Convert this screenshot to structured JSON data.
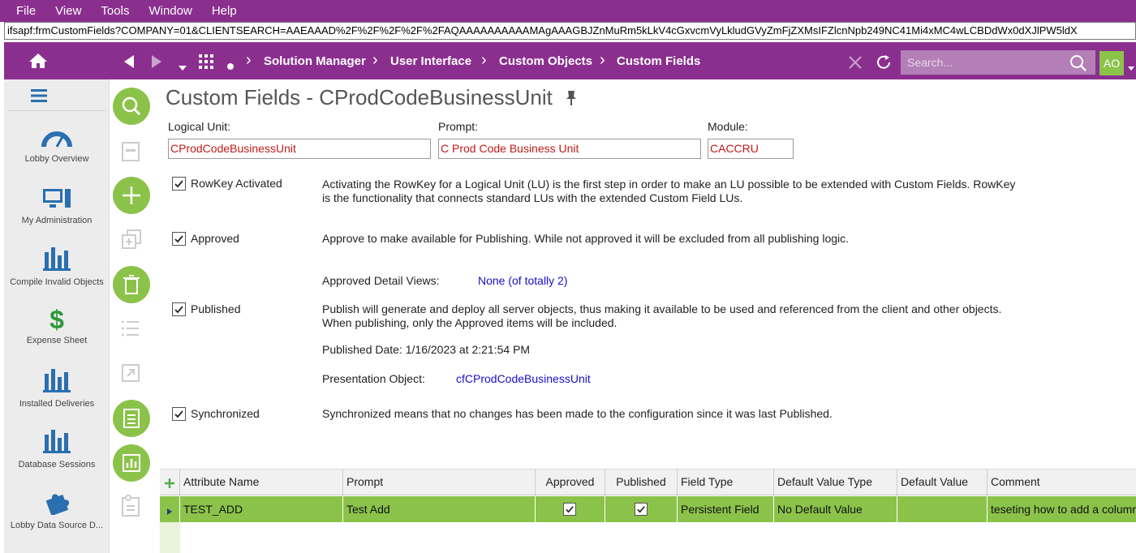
{
  "menubar": {
    "file": "File",
    "view": "View",
    "tools": "Tools",
    "window": "Window",
    "help": "Help"
  },
  "url": "ifsapf:frmCustomFields?COMPANY=01&CLIENTSEARCH=AAEAAAD%2F%2F%2F%2F%2FAQAAAAAAAAAAMAgAAAGBJZnMuRm5kLkV4cGxvcmVyLkludGVyZmFjZXMsIFZlcnNpb249NC41Mi4xMC4wLCBDdWx0dXJlPW5ldX",
  "nav": {
    "breadcrumbs": [
      "Solution Manager",
      "User Interface",
      "Custom Objects",
      "Custom Fields"
    ],
    "search_placeholder": "Search...",
    "avatar": "AO"
  },
  "sidebar": {
    "items": [
      {
        "label": "Lobby Overview",
        "icon": "gauge-icon"
      },
      {
        "label": "My Administration",
        "icon": "computer-icon"
      },
      {
        "label": "Compile Invalid Objects",
        "icon": "bar-chart-icon"
      },
      {
        "label": "Expense Sheet",
        "icon": "dollar-icon"
      },
      {
        "label": "Installed Deliveries",
        "icon": "bar-chart-icon"
      },
      {
        "label": "Database Sessions",
        "icon": "bar-chart-icon"
      },
      {
        "label": "Lobby Data Source D...",
        "icon": "puzzle-icon"
      }
    ]
  },
  "page": {
    "title": "Custom Fields - CProdCodeBusinessUnit",
    "logical_unit_label": "Logical Unit:",
    "logical_unit_value": "CProdCodeBusinessUnit",
    "prompt_label": "Prompt:",
    "prompt_value": "C Prod Code Business Unit",
    "module_label": "Module:",
    "module_value": "CACCRU",
    "rowkey_label": "RowKey Activated",
    "rowkey_desc_1": "Activating the RowKey for a Logical Unit (LU) is the first step in order to make an LU possible to be extended with Custom Fields. RowKey",
    "rowkey_desc_2": "is the functionality that connects standard LUs with the extended Custom Field LUs.",
    "approved_label": "Approved",
    "approved_desc": "Approve to make available for Publishing. While not approved it will be excluded from all publishing logic.",
    "approved_views_label": "Approved Detail Views:",
    "approved_views_value": "None (of totally 2)",
    "published_label": "Published",
    "published_desc_1": "Publish will generate and deploy all server objects, thus making it available to be used and referenced from the client and other objects.",
    "published_desc_2": "When publishing, only the Approved items will be included.",
    "published_date": "Published Date: 1/16/2023 at 2:21:54 PM",
    "presentation_label": "Presentation Object:",
    "presentation_value": "cfCProdCodeBusinessUnit",
    "synchronized_label": "Synchronized",
    "synchronized_desc": "Synchronized means that no changes has been made to the configuration since it was last Published."
  },
  "grid": {
    "headers": [
      "Attribute Name",
      "Prompt",
      "Approved",
      "Published",
      "Field Type",
      "Default Value Type",
      "Default Value",
      "Comment"
    ],
    "rows": [
      {
        "attribute": "TEST_ADD",
        "prompt": "Test Add",
        "approved": true,
        "published": true,
        "field_type": "Persistent Field",
        "default_value_type": "No Default Value",
        "default_value": "",
        "comment": "teseting how to add a column"
      }
    ]
  },
  "colors": {
    "brand_purple": "#8b2f8f",
    "accent_green": "#8bc34a",
    "error_red": "#c21a1a",
    "link_blue": "#1a0dcc"
  }
}
